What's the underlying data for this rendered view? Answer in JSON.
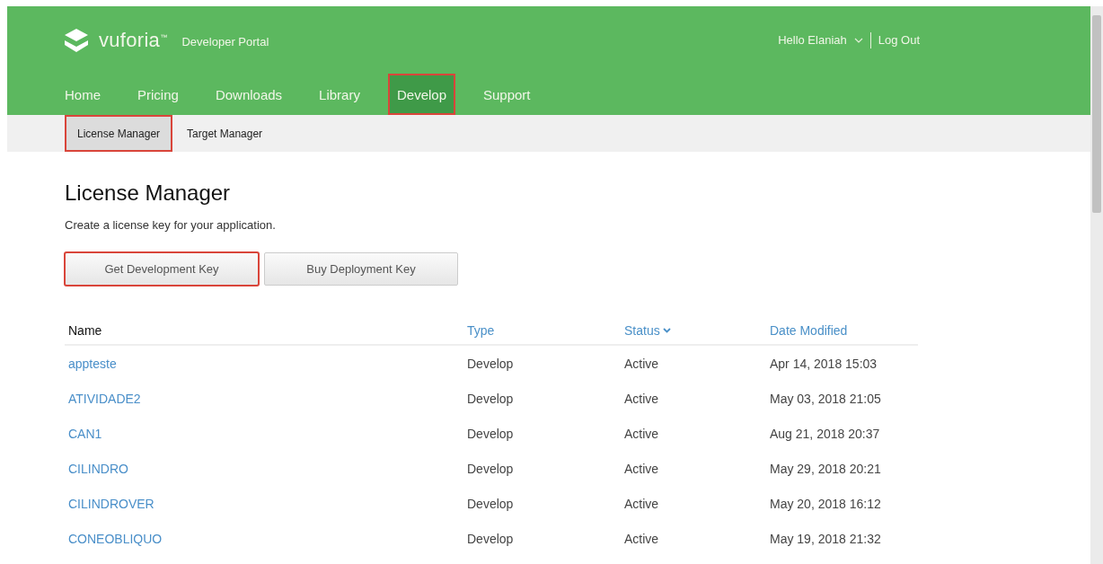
{
  "header": {
    "brand": "vuforia",
    "brand_mark": "™",
    "subtitle": "Developer Portal",
    "user": "Hello Elaniah",
    "logout": "Log Out"
  },
  "nav": [
    {
      "label": "Home",
      "selected": false,
      "highlighted": false
    },
    {
      "label": "Pricing",
      "selected": false,
      "highlighted": false
    },
    {
      "label": "Downloads",
      "selected": false,
      "highlighted": false
    },
    {
      "label": "Library",
      "selected": false,
      "highlighted": false
    },
    {
      "label": "Develop",
      "selected": true,
      "highlighted": true
    },
    {
      "label": "Support",
      "selected": false,
      "highlighted": false
    }
  ],
  "subnav": [
    {
      "label": "License Manager",
      "selected": true,
      "highlighted": true
    },
    {
      "label": "Target Manager",
      "selected": false,
      "highlighted": false
    }
  ],
  "page": {
    "title": "License Manager",
    "description": "Create a license key for your application."
  },
  "buttons": [
    {
      "label": "Get Development Key",
      "highlighted": true
    },
    {
      "label": "Buy Deployment Key",
      "highlighted": false
    }
  ],
  "table": {
    "columns": [
      {
        "label": "Name",
        "sortable": false,
        "sorted": false
      },
      {
        "label": "Type",
        "sortable": true,
        "sorted": false
      },
      {
        "label": "Status",
        "sortable": true,
        "sorted": true
      },
      {
        "label": "Date Modified",
        "sortable": true,
        "sorted": false
      }
    ],
    "rows": [
      [
        "appteste",
        "Develop",
        "Active",
        "Apr 14, 2018 15:03"
      ],
      [
        "ATIVIDADE2",
        "Develop",
        "Active",
        "May 03, 2018 21:05"
      ],
      [
        "CAN1",
        "Develop",
        "Active",
        "Aug 21, 2018 20:37"
      ],
      [
        "CILINDRO",
        "Develop",
        "Active",
        "May 29, 2018 20:21"
      ],
      [
        "CILINDROVER",
        "Develop",
        "Active",
        "May 20, 2018 16:12"
      ],
      [
        "CONEOBLIQUO",
        "Develop",
        "Active",
        "May 19, 2018 21:32"
      ]
    ]
  }
}
